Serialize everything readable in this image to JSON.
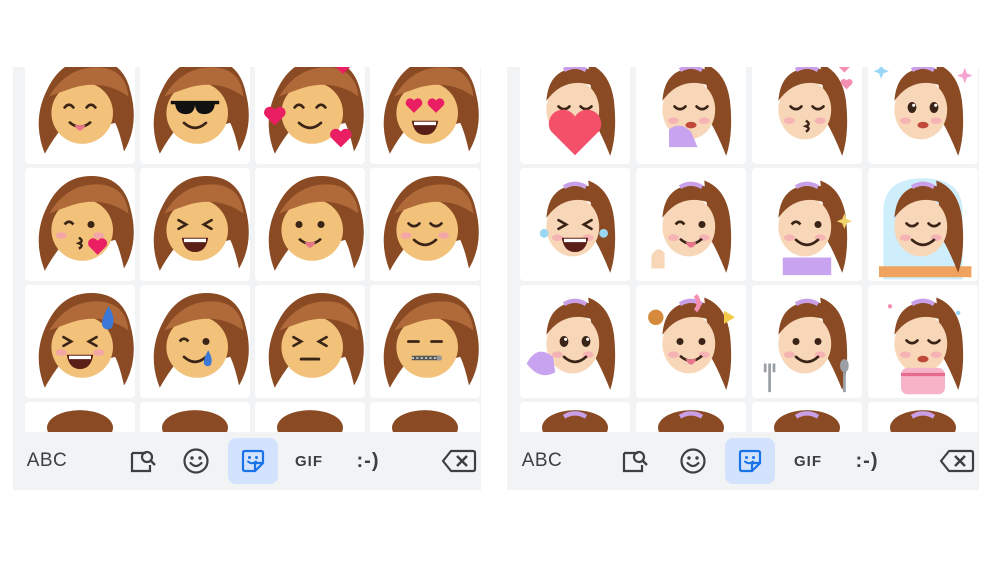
{
  "keyboard_left": {
    "toolbar": {
      "abc_label": "ABC",
      "gif_label": "GIF",
      "emoticon_label": ":-)",
      "icons": [
        "search-sticker-icon",
        "emoji-icon",
        "sticker-icon",
        "backspace-icon"
      ],
      "active_tab": "sticker"
    },
    "stickers": [
      "tongue-out",
      "sunglasses",
      "hearts-around",
      "heart-eyes",
      "wink-kiss",
      "laughing",
      "tongue-out-smile",
      "blushing-smile",
      "sweat-laugh",
      "tearful-smile",
      "expressionless",
      "zipper-mouth"
    ]
  },
  "keyboard_right": {
    "toolbar": {
      "abc_label": "ABC",
      "gif_label": "GIF",
      "emoticon_label": ":-)",
      "icons": [
        "search-sticker-icon",
        "emoji-icon",
        "sticker-icon",
        "backspace-icon"
      ],
      "active_tab": "sticker"
    },
    "stickers": [
      "holding-heart",
      "giggling",
      "kissing-hearts",
      "pleading-sparkles",
      "tearful-laughing",
      "winking",
      "thinking-sparkles",
      "sunrise-window",
      "lying-chin-in-hands",
      "food-dreaming",
      "yummy-fork-spoon",
      "birthday-cake"
    ]
  },
  "colors": {
    "panel_bg": "#f1f3f4",
    "tile_bg": "#ffffff",
    "active_tab_bg": "#d3e3fd",
    "active_icon": "#1a73e8",
    "icon_color": "#3c4043",
    "hair_dark": "#8a4a23",
    "hair_light": "#b06a3a",
    "skin": "#f7d7b8"
  }
}
